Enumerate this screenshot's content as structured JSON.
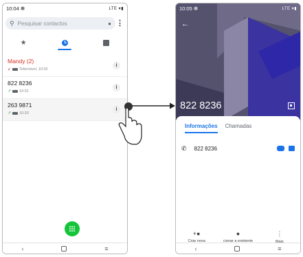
{
  "left_phone": {
    "status": {
      "time": "10:04",
      "icons_right": "LTE ▾▮"
    },
    "search": {
      "placeholder": "Pesquisar contactos"
    },
    "tabs": [
      {
        "name": "favorites",
        "icon": "star-icon"
      },
      {
        "name": "recents",
        "icon": "clock-icon",
        "active": true
      },
      {
        "name": "contacts",
        "icon": "contacts-icon"
      }
    ],
    "calls": [
      {
        "name": "Mandy (2)",
        "detail": "Telemóvel, 10:02",
        "missed": true
      },
      {
        "name": "822 8236",
        "detail": "10:31",
        "missed": false
      },
      {
        "name": "263 9871",
        "detail": "10:30",
        "missed": false
      }
    ]
  },
  "right_phone": {
    "status": {
      "time": "10:05",
      "icons_right": "LTE ▾▮"
    },
    "contact_number": "822 8236",
    "tabs": {
      "info": "Informações",
      "calls": "Chamadas"
    },
    "phone_row": {
      "number": "822 8236"
    },
    "actions": [
      {
        "label": "Criar nova",
        "icon": "add-person-icon"
      },
      {
        "label": "cionar a existente",
        "icon": "person-icon"
      },
      {
        "label": "Mais",
        "icon": "more-icon"
      }
    ]
  },
  "colors": {
    "accent": "#1a73e8",
    "missed": "#d93025",
    "dial_fab": "#14c53a",
    "hero": "#3f3b73"
  }
}
